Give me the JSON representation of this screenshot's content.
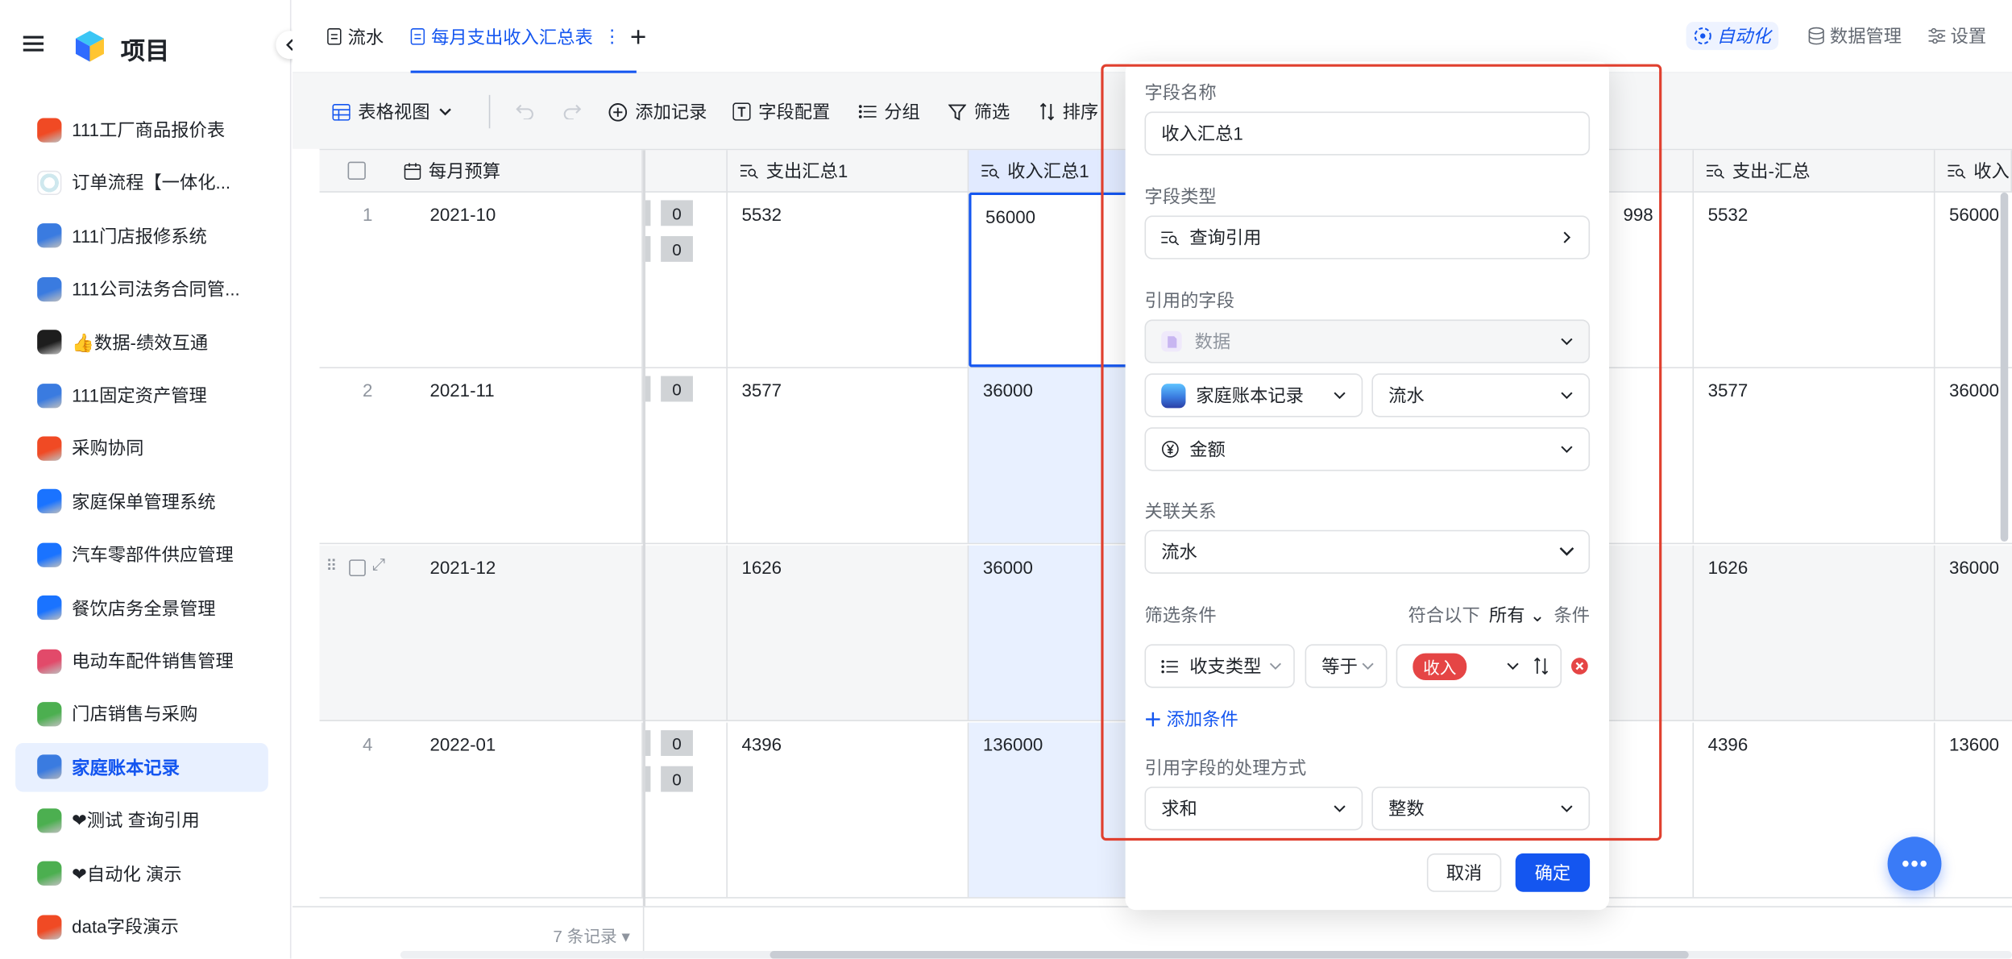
{
  "colors": {
    "accent": "#1456f0",
    "highlight_border": "#e0402f",
    "tag_red": "#e54545",
    "selected_bg": "#e8f0ff",
    "column_highlight": "#e8f0ff"
  },
  "sidebar": {
    "menu_icon": "hamburger-icon",
    "app_title": "项目",
    "collapse_icon": "chevron-left-icon",
    "items": [
      {
        "label": "111工厂商品报价表",
        "color": "#f04a24"
      },
      {
        "label": "订单流程【一体化...",
        "color": "#ffffff"
      },
      {
        "label": "111门店报修系统",
        "color": "#3a7be0"
      },
      {
        "label": "111公司法务合同管...",
        "color": "#3a7be0"
      },
      {
        "label": "👍数据-绩效互通",
        "color": "#1d1d1d"
      },
      {
        "label": "111固定资产管理",
        "color": "#3a7be0"
      },
      {
        "label": "采购协同",
        "color": "#f04a24"
      },
      {
        "label": "家庭保单管理系统",
        "color": "#1a73ff"
      },
      {
        "label": "汽车零部件供应管理",
        "color": "#1a73ff"
      },
      {
        "label": "餐饮店务全景管理",
        "color": "#1a73ff"
      },
      {
        "label": "电动车配件销售管理",
        "color": "#e24a6a"
      },
      {
        "label": "门店销售与采购",
        "color": "#4caf50"
      },
      {
        "label": "家庭账本记录",
        "color": "#3a7be0",
        "active": true
      },
      {
        "label": "❤测试 查询引用",
        "color": "#4caf50"
      },
      {
        "label": "❤自动化 演示",
        "color": "#4caf50"
      },
      {
        "label": "data字段演示",
        "color": "#f04a24"
      }
    ]
  },
  "topbar": {
    "tabs": [
      {
        "label": "流水",
        "active": false
      },
      {
        "label": "每月支出收入汇总表",
        "active": true
      }
    ],
    "add_tab": "+",
    "right": {
      "automation": "自动化",
      "data_management": "数据管理",
      "settings": "设置"
    }
  },
  "toolbar": {
    "view": "表格视图",
    "add_record": "添加记录",
    "field_config": "字段配置",
    "group": "分组",
    "filter": "筛选",
    "sort": "排序"
  },
  "grid": {
    "columns": {
      "month_budget": "每月预算",
      "expense_total": "支出汇总1",
      "income_total": "收入汇总1",
      "expense_total2": "支出-汇总",
      "income_total2": "收入"
    },
    "rows": [
      {
        "num": "1",
        "month": "2021-10",
        "expense": "5532",
        "income": "56000",
        "partial": "998",
        "expense2": "5532",
        "income2": "56000",
        "badges": [
          "0",
          "0"
        ]
      },
      {
        "num": "2",
        "month": "2021-11",
        "expense": "3577",
        "income": "36000",
        "partial": "",
        "expense2": "3577",
        "income2": "36000",
        "badges": [
          "0"
        ]
      },
      {
        "num": "",
        "month": "2021-12",
        "expense": "1626",
        "income": "36000",
        "partial": "",
        "expense2": "1626",
        "income2": "36000",
        "badges": []
      },
      {
        "num": "4",
        "month": "2022-01",
        "expense": "4396",
        "income": "136000",
        "partial": "",
        "expense2": "4396",
        "income2": "13600",
        "badges": [
          "0",
          "0"
        ]
      }
    ],
    "footer_count": "7 条记录"
  },
  "panel": {
    "field_name_label": "字段名称",
    "field_name_value": "收入汇总1",
    "field_type_label": "字段类型",
    "field_type_value": "查询引用",
    "ref_field_label": "引用的字段",
    "ref_source": "数据",
    "ref_table": "家庭账本记录",
    "ref_sheet": "流水",
    "ref_column": "金额",
    "relation_label": "关联关系",
    "relation_value": "流水",
    "filter_label": "筛选条件",
    "filter_match_prefix": "符合以下",
    "filter_match_mode": "所有",
    "filter_match_suffix": "条件",
    "cond_field": "收支类型",
    "cond_op": "等于",
    "cond_value": "收入",
    "add_condition": "添加条件",
    "processing_label": "引用字段的处理方式",
    "agg_func": "求和",
    "number_format": "整数",
    "cancel": "取消",
    "confirm": "确定"
  }
}
